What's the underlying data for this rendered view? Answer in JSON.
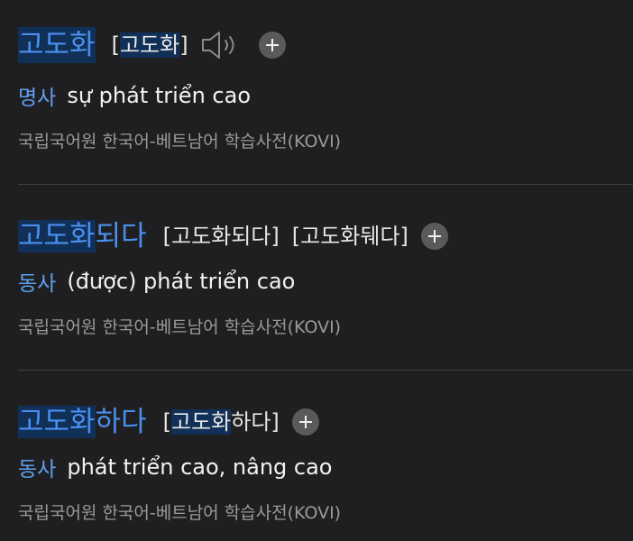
{
  "entries": [
    {
      "word_highlight": "고도화",
      "word_rest": "",
      "pronunciations": [
        {
          "open": "[",
          "highlight": "고도화",
          "rest": "",
          "close": "]"
        }
      ],
      "has_speaker": true,
      "pos": "명사",
      "meaning": "sự phát triển cao",
      "source": "국립국어원 한국어-베트남어 학습사전(KOVI)"
    },
    {
      "word_highlight": "고도화",
      "word_rest": "되다",
      "pronunciations": [
        {
          "open": "[",
          "highlight": "",
          "rest": "고도화되다",
          "close": "]"
        },
        {
          "open": "[",
          "highlight": "",
          "rest": "고도화뒈다",
          "close": "]"
        }
      ],
      "has_speaker": false,
      "pos": "동사",
      "meaning": "(được) phát triển cao",
      "source": "국립국어원 한국어-베트남어 학습사전(KOVI)"
    },
    {
      "word_highlight": "고도화",
      "word_rest": "하다",
      "pronunciations": [
        {
          "open": "[",
          "highlight": "고도화",
          "rest": "하다",
          "close": "]"
        }
      ],
      "has_speaker": false,
      "pos": "동사",
      "meaning": "phát triển cao, nâng cao",
      "source": "국립국어원 한국어-베트남어 학습사전(KOVI)"
    }
  ],
  "icons": {
    "speaker": "speaker-icon",
    "add": "plus-icon"
  },
  "colors": {
    "background": "#1f1f21",
    "word": "#4a8ff0",
    "highlight_bg": "#113057",
    "pos": "#5fa0ef",
    "source": "#9a9a9c"
  }
}
